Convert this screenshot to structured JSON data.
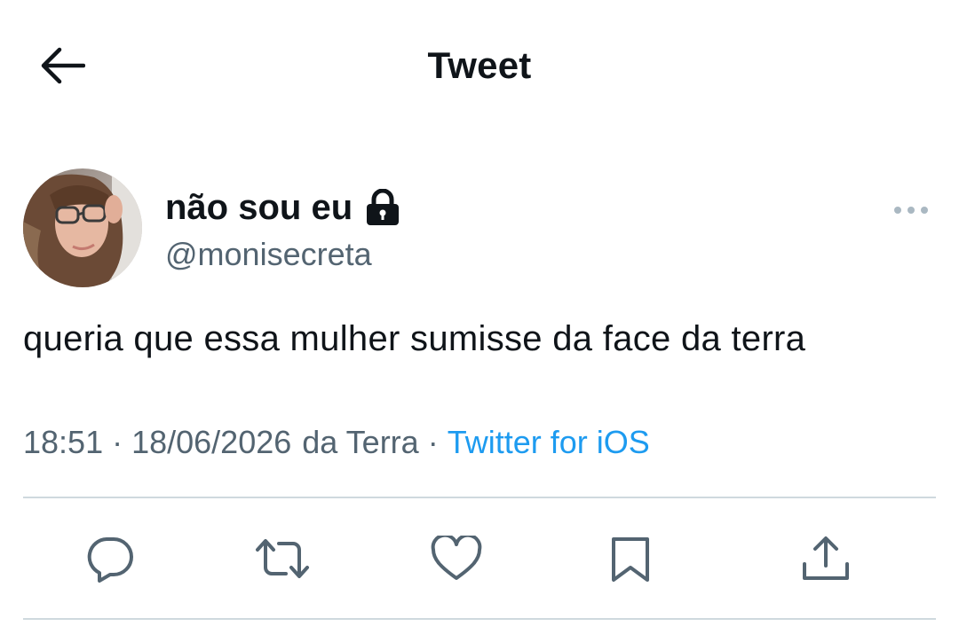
{
  "header": {
    "title": "Tweet",
    "back_icon": "arrow-left-icon"
  },
  "author": {
    "display_name": "não sou eu",
    "handle": "@monisecreta",
    "protected_icon": "lock-icon",
    "more_icon": "more-horizontal-icon"
  },
  "tweet": {
    "text": "queria que essa mulher sumisse da face da terra",
    "time": "18:51",
    "date": "18/06/2026",
    "location": "da Terra",
    "separator": "·",
    "source": "Twitter for iOS"
  },
  "actions": [
    {
      "name": "reply",
      "icon": "reply-icon"
    },
    {
      "name": "retweet",
      "icon": "retweet-icon"
    },
    {
      "name": "like",
      "icon": "heart-icon"
    },
    {
      "name": "bookmark",
      "icon": "bookmark-icon"
    },
    {
      "name": "share",
      "icon": "share-icon"
    }
  ],
  "colors": {
    "text": "#0f1419",
    "secondary": "#536471",
    "link": "#1d9bf0",
    "divider": "#cfd9de"
  }
}
